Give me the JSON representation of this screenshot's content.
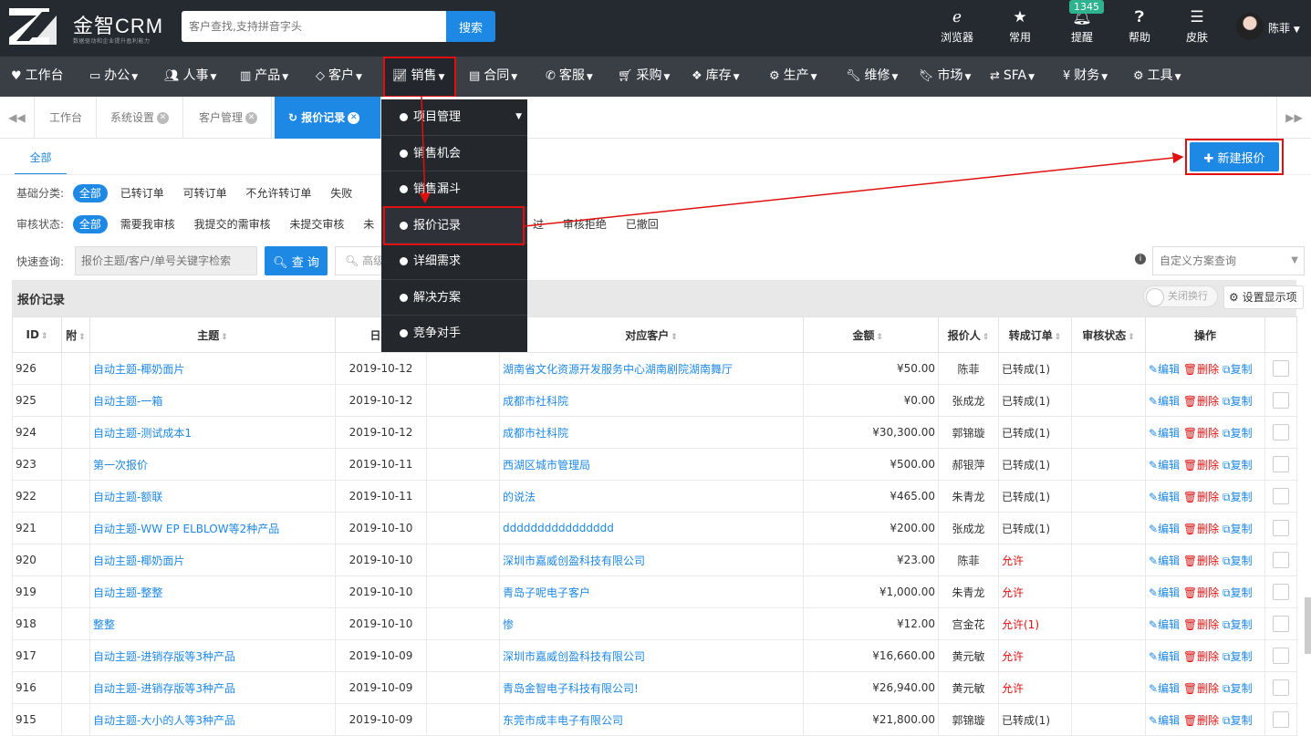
{
  "brand": {
    "name": "金智CRM",
    "slogan": "数据驱动和企业提升盈利能力"
  },
  "search": {
    "placeholder": "客户查找,支持拼音字头",
    "button": "搜索"
  },
  "tools": [
    {
      "icon": "browser-icon",
      "label": "浏览器"
    },
    {
      "icon": "star-icon",
      "label": "常用"
    },
    {
      "icon": "bell-icon",
      "label": "提醒",
      "badge": "1345"
    },
    {
      "icon": "help-icon",
      "label": "帮助"
    },
    {
      "icon": "skin-icon",
      "label": "皮肤"
    }
  ],
  "user": {
    "name": "陈菲"
  },
  "nav": [
    {
      "label": "工作台",
      "icon": "heart-icon"
    },
    {
      "label": "办公",
      "icon": "laptop-icon"
    },
    {
      "label": "人事",
      "icon": "users-icon"
    },
    {
      "label": "产品",
      "icon": "barcode-icon"
    },
    {
      "label": "客户",
      "icon": "diamond-icon"
    },
    {
      "label": "销售",
      "icon": "line-chart-icon"
    },
    {
      "label": "合同",
      "icon": "contract-icon"
    },
    {
      "label": "客服",
      "icon": "phone-icon"
    },
    {
      "label": "采购",
      "icon": "cart-icon"
    },
    {
      "label": "库存",
      "icon": "cubes-icon"
    },
    {
      "label": "生产",
      "icon": "cogs-icon"
    },
    {
      "label": "维修",
      "icon": "wrench-icon"
    },
    {
      "label": "市场",
      "icon": "bookmark-icon"
    },
    {
      "label": "SFA",
      "icon": "exchange-icon"
    },
    {
      "label": "财务",
      "icon": "yen-icon"
    },
    {
      "label": "工具",
      "icon": "gear-icon"
    }
  ],
  "tabs": [
    {
      "label": "工作台"
    },
    {
      "label": "系统设置"
    },
    {
      "label": "客户管理"
    },
    {
      "label": "报价记录",
      "active": true
    }
  ],
  "sales_menu": [
    "项目管理",
    "销售机会",
    "销售漏斗",
    "报价记录",
    "详细需求",
    "解决方案",
    "竞争对手"
  ],
  "subtab": "全部",
  "new_button": "新建报价",
  "filters": {
    "base": {
      "label": "基础分类:",
      "options": [
        "全部",
        "已转订单",
        "可转订单",
        "不允许转订单",
        "失败"
      ]
    },
    "audit": {
      "label": "审核状态:",
      "options": [
        "全部",
        "需要我审核",
        "我提交的需审核",
        "未提交审核",
        "未",
        "过",
        "审核拒绝",
        "已撤回"
      ]
    }
  },
  "quick": {
    "label": "快速查询:",
    "placeholder": "报价主题/客户/单号关键字检索",
    "button": "查 询",
    "advanced": "高级"
  },
  "custom_query": "自定义方案查询",
  "panel": {
    "title": "报价记录",
    "wrap_label": "关闭换行",
    "display_label": "设置显示项"
  },
  "table": {
    "headers": [
      "ID",
      "附",
      "主题",
      "日期",
      "",
      "对应客户",
      "金额",
      "报价人",
      "转成订单",
      "审核状态",
      "操作",
      ""
    ],
    "ops": [
      "编辑",
      "删除",
      "复制"
    ],
    "rows": [
      {
        "id": "926",
        "subject": "自动主题-椰奶面片",
        "date": "2019-10-12",
        "customer": "湖南省文化资源开发服务中心湖南剧院湖南舞厅",
        "amount": "¥50.00",
        "person": "陈菲",
        "order": "已转成(1)"
      },
      {
        "id": "925",
        "subject": "自动主题-一箱",
        "date": "2019-10-12",
        "customer": "成都市社科院",
        "amount": "¥0.00",
        "person": "张成龙",
        "order": "已转成(1)"
      },
      {
        "id": "924",
        "subject": "自动主题-测试成本1",
        "date": "2019-10-12",
        "customer": "成都市社科院",
        "amount": "¥30,300.00",
        "person": "郭锦璇",
        "order": "已转成(1)"
      },
      {
        "id": "923",
        "subject": "第一次报价",
        "date": "2019-10-11",
        "customer": "西湖区城市管理局",
        "amount": "¥500.00",
        "person": "郝银萍",
        "order": "已转成(1)"
      },
      {
        "id": "922",
        "subject": "自动主题-额联",
        "date": "2019-10-11",
        "customer": "的说法",
        "amount": "¥465.00",
        "person": "朱青龙",
        "order": "已转成(1)"
      },
      {
        "id": "921",
        "subject": "自动主题-WW EP ELBLOW等2种产品",
        "date": "2019-10-10",
        "customer": "dddddddddddddddd",
        "amount": "¥200.00",
        "person": "张成龙",
        "order": "已转成(1)"
      },
      {
        "id": "920",
        "subject": "自动主题-椰奶面片",
        "date": "2019-10-10",
        "customer": "深圳市嘉威创盈科技有限公司",
        "amount": "¥23.00",
        "person": "陈菲",
        "order": "允许"
      },
      {
        "id": "919",
        "subject": "自动主题-整整",
        "date": "2019-10-10",
        "customer": "青岛子呢电子客户",
        "amount": "¥1,000.00",
        "person": "朱青龙",
        "order": "允许"
      },
      {
        "id": "918",
        "subject": "整整",
        "date": "2019-10-10",
        "customer": "惨",
        "amount": "¥12.00",
        "person": "宫金花",
        "order": "允许(1)"
      },
      {
        "id": "917",
        "subject": "自动主题-进销存版等3种产品",
        "date": "2019-10-09",
        "customer": "深圳市嘉威创盈科技有限公司",
        "amount": "¥16,660.00",
        "person": "黄元敏",
        "order": "允许"
      },
      {
        "id": "916",
        "subject": "自动主题-进销存版等3种产品",
        "date": "2019-10-09",
        "customer": "青岛金智电子科技有限公司!",
        "amount": "¥26,940.00",
        "person": "黄元敏",
        "order": "允许"
      },
      {
        "id": "915",
        "subject": "自动主题-大小的人等3种产品",
        "date": "2019-10-09",
        "customer": "东莞市成丰电子有限公司",
        "amount": "¥21,800.00",
        "person": "郭锦璇",
        "order": "已转成(1)"
      }
    ]
  },
  "colors": {
    "topbar": "#252a31",
    "navbar": "#3a3f46",
    "accent": "#1e88e5",
    "highlight": "#e01010",
    "menu": "#24272b"
  }
}
